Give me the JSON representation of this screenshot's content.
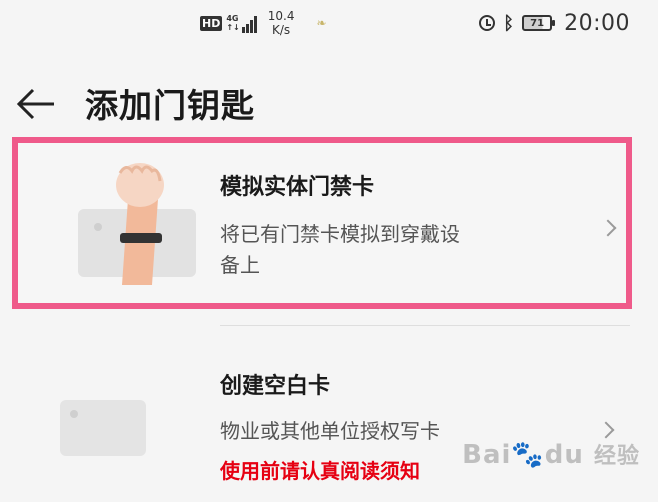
{
  "status_bar": {
    "hd": "HD",
    "net_type": "4G",
    "net_sub": "↑↓",
    "speed_value": "10.4",
    "speed_unit": "K/s",
    "battery": "71",
    "time": "20:00",
    "icons": [
      "hd-icon",
      "signal-icon",
      "leaf-icon",
      "alarm-icon",
      "bluetooth-icon",
      "battery-icon"
    ]
  },
  "header": {
    "title": "添加门钥匙",
    "back_icon": "arrow-left-icon"
  },
  "items": [
    {
      "title": "模拟实体门禁卡",
      "desc_line1": "将已有门禁卡模拟到穿戴设",
      "desc_line2": "备上",
      "icon": "wrist-card-illustration"
    },
    {
      "title": "创建空白卡",
      "desc": "物业或其他单位授权写卡",
      "warning": "使用前请认真阅读须知",
      "icon": "blank-card-illustration"
    }
  ],
  "highlight_color": "#ef5a8a",
  "warning_color": "#e60012",
  "watermark": {
    "text": "Bai",
    "logo": "du",
    "suffix": "经验"
  }
}
